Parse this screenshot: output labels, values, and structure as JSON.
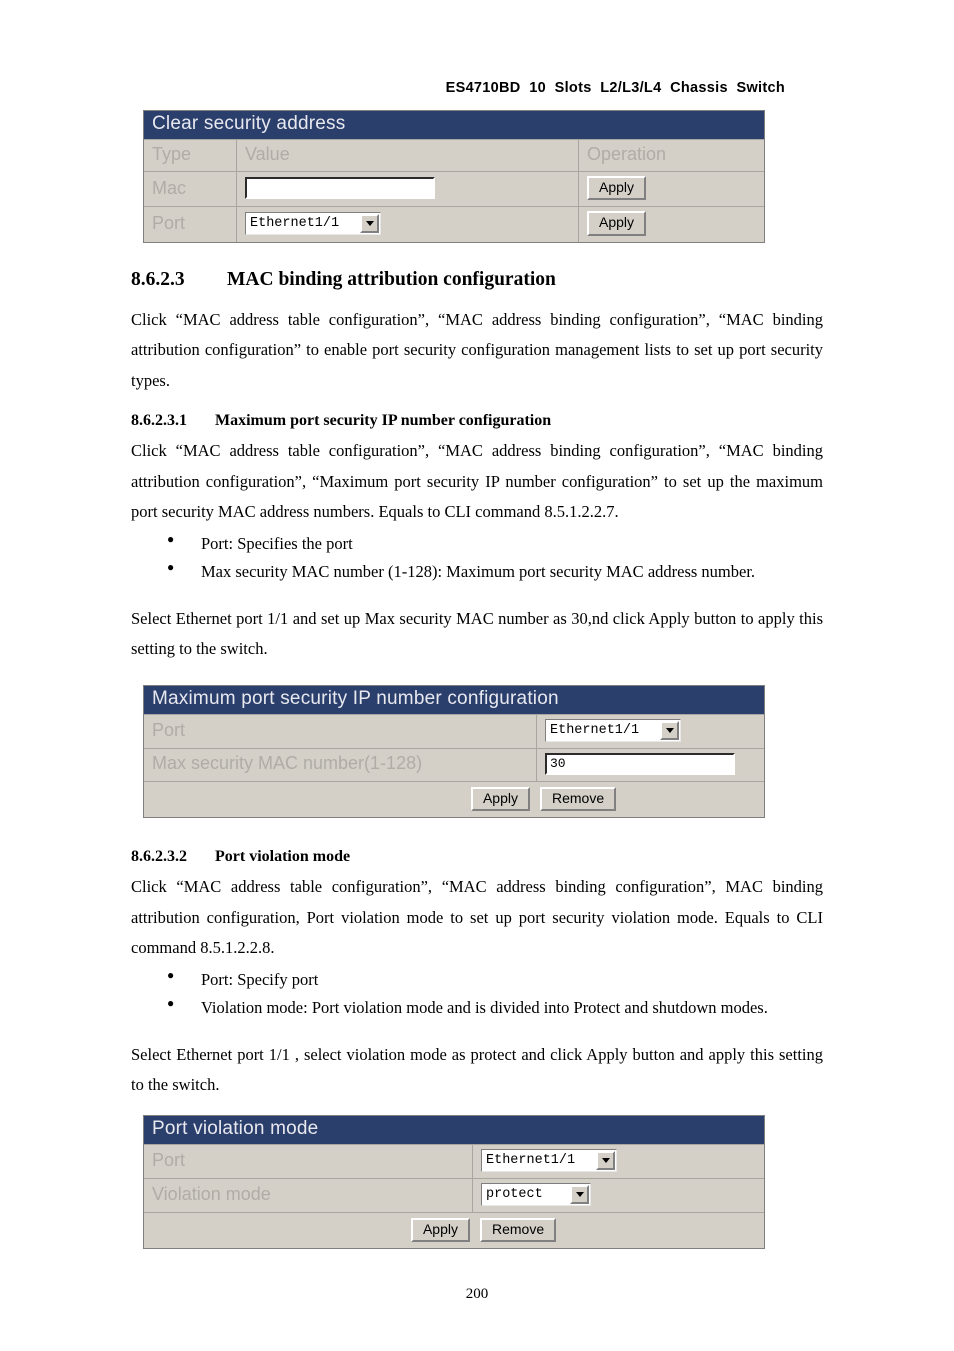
{
  "header": {
    "title": "ES4710BD  10  Slots  L2/L3/L4  Chassis  Switch"
  },
  "panel_clear_security": {
    "title": "Clear security address",
    "columns": [
      "Type",
      "Value",
      "Operation"
    ],
    "rows": [
      {
        "type": "Mac",
        "value": "",
        "value_kind": "textbox",
        "operation": "Apply"
      },
      {
        "type": "Port",
        "value": "Ethernet1/1",
        "value_kind": "select",
        "operation": "Apply"
      }
    ]
  },
  "section_8623": {
    "number": "8.6.2.3",
    "title": "MAC binding attribution configuration",
    "paragraph": "Click “MAC address table configuration”, “MAC address binding configuration”, “MAC binding attribution configuration” to enable port security configuration management lists to set up port security types."
  },
  "section_86231": {
    "number": "8.6.2.3.1",
    "title": "Maximum port security IP number configuration",
    "paragraph": "Click “MAC address table configuration”, “MAC address binding configuration”, “MAC binding attribution configuration”, “Maximum port security IP number configuration” to set up the maximum port security MAC address numbers. Equals to CLI command 8.5.1.2.2.7.",
    "bullets": [
      "Port: Specifies the port",
      "Max security MAC number (1-128): Maximum port security MAC address number."
    ],
    "note": "Select Ethernet port 1/1 and set up Max security MAC number as 30,nd click Apply button to apply this setting to the switch."
  },
  "panel_max_security": {
    "title": "Maximum port security IP number configuration",
    "rows": [
      {
        "label": "Port",
        "value": "Ethernet1/1",
        "kind": "select"
      },
      {
        "label": "Max security MAC number(1-128)",
        "value": "30",
        "kind": "textbox"
      }
    ],
    "buttons": [
      "Apply",
      "Remove"
    ]
  },
  "section_86232": {
    "number": "8.6.2.3.2",
    "title": "Port violation mode",
    "paragraph": "Click “MAC address table configuration”, “MAC address binding configuration”, MAC binding attribution configuration, Port violation mode to set up port security violation mode. Equals to CLI command 8.5.1.2.2.8.",
    "bullets": [
      "Port: Specify port",
      "Violation mode: Port violation mode and is divided into Protect and shutdown modes."
    ],
    "note": "Select Ethernet port 1/1 , select violation mode as protect and click Apply button and apply this setting to the switch."
  },
  "panel_violation": {
    "title": "Port violation mode",
    "rows": [
      {
        "label": "Port",
        "value": "Ethernet1/1",
        "kind": "select"
      },
      {
        "label": "Violation mode",
        "value": "protect",
        "kind": "select"
      }
    ],
    "buttons": [
      "Apply",
      "Remove"
    ]
  },
  "footer": {
    "page_number": "200"
  }
}
